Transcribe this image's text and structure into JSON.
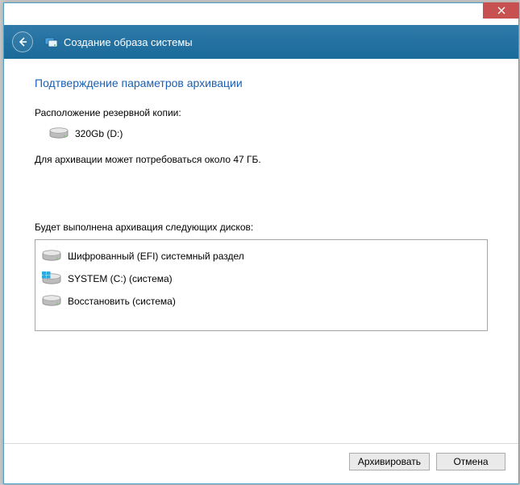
{
  "header": {
    "title": "Создание образа системы"
  },
  "subtitle": "Подтверждение параметров архивации",
  "backup_location_label": "Расположение резервной копии:",
  "backup_drive": "320Gb (D:)",
  "size_info": "Для архивации может потребоваться около 47 ГБ.",
  "disk_list_label": "Будет выполнена архивация следующих дисков:",
  "disks": [
    {
      "name": "Шифрованный (EFI) системный раздел",
      "icon": "hdd"
    },
    {
      "name": "SYSTEM (C:) (система)",
      "icon": "win-hdd"
    },
    {
      "name": "Восстановить (система)",
      "icon": "hdd"
    }
  ],
  "buttons": {
    "archive": "Архивировать",
    "cancel": "Отмена"
  }
}
